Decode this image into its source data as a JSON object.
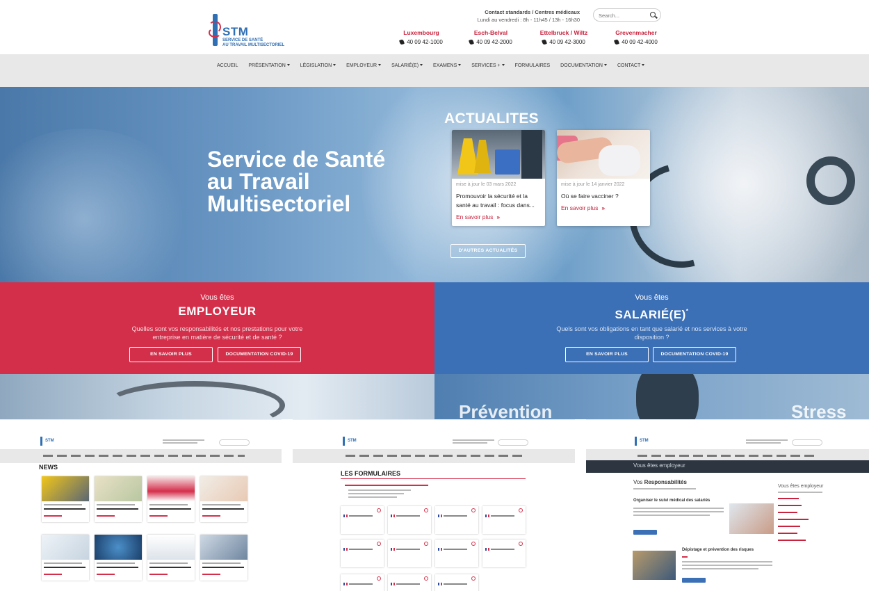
{
  "header": {
    "logo_title": "STM",
    "logo_subtitle_1": "SERVICE DE SANTÉ",
    "logo_subtitle_2": "AU TRAVAIL MULTISECTORIEL",
    "contact_title": "Contact standards / Centres médicaux",
    "contact_hours": "Lundi au vendredi : 8h - 11h45 / 13h - 16h30",
    "search_placeholder": "Search...",
    "locations": [
      {
        "city": "Luxembourg",
        "phone": "40 09 42-1000"
      },
      {
        "city": "Esch-Belval",
        "phone": "40 09 42-2000"
      },
      {
        "city": "Ettelbruck / Wiltz",
        "phone": "40 09 42-3000"
      },
      {
        "city": "Grevenmacher",
        "phone": "40 09 42-4000"
      }
    ]
  },
  "nav": {
    "items": [
      {
        "label": "ACCUEIL"
      },
      {
        "label": "PRÉSENTATION"
      },
      {
        "label": "LÉGISLATION"
      },
      {
        "label": "EMPLOYEUR"
      },
      {
        "label": "SALARIÉ(E)"
      },
      {
        "label": "EXAMENS"
      },
      {
        "label": "SERVICES +"
      },
      {
        "label": "FORMULAIRES"
      },
      {
        "label": "DOCUMENTATION"
      },
      {
        "label": "CONTACT"
      }
    ]
  },
  "hero": {
    "title_1": "Service de Santé",
    "title_2": "au Travail",
    "title_3": "Multisectoriel",
    "news_heading": "ACTUALITES",
    "cards": [
      {
        "date": "mise à jour le 03 mars 2022",
        "title_1": "Promouvoir la sécurité et la",
        "title_2": "santé au travail : focus dans...",
        "more": "En savoir plus"
      },
      {
        "date": "mise à jour le 14 janvier 2022",
        "title_1": "Où se faire vacciner ?",
        "title_2": "",
        "more": "En savoir plus"
      }
    ],
    "other_news": "D'AUTRES ACTUALITÉS"
  },
  "employeur": {
    "intro": "Vous êtes",
    "title": "EMPLOYEUR",
    "desc_1": "Quelles sont vos responsabilités et nos prestations pour votre",
    "desc_2": "entreprise en matière de sécurité et de santé ?",
    "btn_more": "EN SAVOIR PLUS",
    "btn_covid": "DOCUMENTATION COVID-19"
  },
  "salarie": {
    "intro": "Vous êtes",
    "title": "SALARIÉ(E)",
    "sup": "*",
    "desc_1": "Quels sont vos obligations en tant que salarié et nos services à votre",
    "desc_2": "disposition ?",
    "btn_more": "EN SAVOIR PLUS",
    "btn_covid": "DOCUMENTATION COVID-19"
  },
  "strip": {
    "left_text": "Prévention",
    "right_text": "Stress"
  },
  "thumbnails": {
    "news_title": "NEWS",
    "forms_title": "LES FORMULAIRES",
    "employer_bar": "Vous êtes employeur",
    "resp_prefix": "Vos",
    "resp_word": "Responsabilités",
    "side_title": "Vous êtes employeur",
    "item_1": "Organiser le suivi médical des salariés",
    "item_2": "Dépistage et prévention des risques"
  },
  "colors": {
    "red": "#d42f4a",
    "blue": "#3b6fb6",
    "nav_bg": "#e8e8e8"
  }
}
